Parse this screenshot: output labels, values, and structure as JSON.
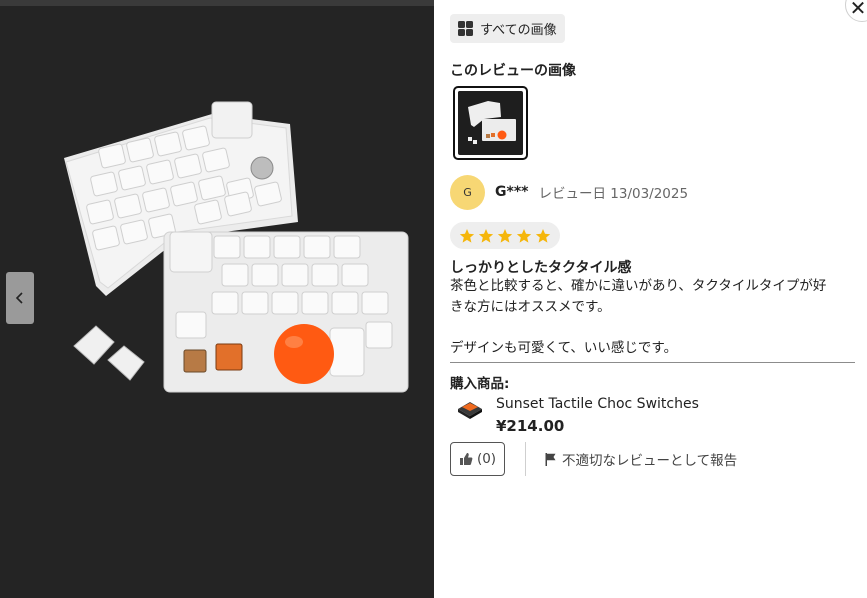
{
  "modal": {
    "all_images_label": "すべての画像",
    "images_section_title": "このレビューの画像",
    "reviewer": {
      "avatar_initial": "G",
      "name": "G***",
      "date": "レビュー日 13/03/2025"
    },
    "rating": {
      "stars": 5,
      "max": 5
    },
    "review_title": "しっかりとしたタクタイル感",
    "review_body": [
      "茶色と比較すると、確かに違いがあり、タクタイルタイプが好",
      "きな方にはオススメです。",
      "",
      "デザインも可愛くて、いい感じです。"
    ],
    "purchased_label": "購入商品:",
    "product": {
      "name": "Sunset Tactile Choc Switches",
      "price": "¥214.00"
    },
    "like_count": "(0)",
    "report_label": "不適切なレビューとして報告",
    "close_symbol": "✕",
    "icons": {
      "grid": "grid-icon",
      "prev": "chevron-left-icon",
      "close": "close-icon",
      "star": "star-icon",
      "like": "thumbs-up-icon",
      "report": "flag-icon"
    },
    "colors": {
      "star": "#f5b60b",
      "avatar": "#f7d774",
      "photo_bg": "#232323",
      "ball": "#ff5a12"
    }
  }
}
